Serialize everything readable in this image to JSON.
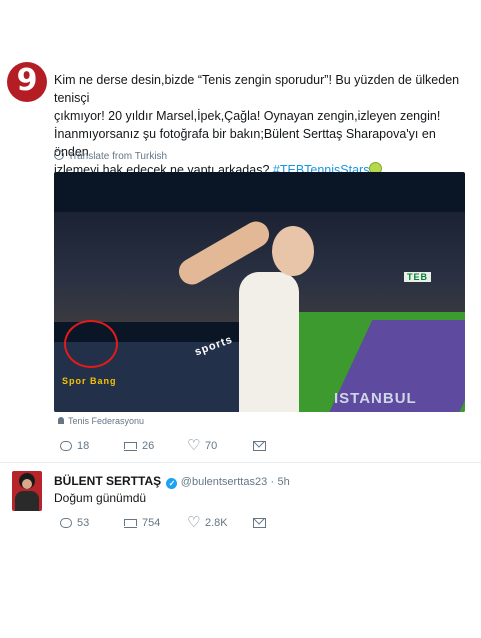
{
  "tweet1": {
    "avatar_text": "9",
    "text_lines": [
      "Kim ne derse desin,bizde “Tenis zengin sporudur”! Bu yüzden de ülkeden tenisçi",
      "çıkmıyor! 20 yıldır Marsel,İpek,Çağla! Oynayan zengin,izleyen zengin!",
      "İnanmıyorsanız şu fotoğrafa  bir bakın;Bülent Serttaş Sharapova'yı en önden",
      "izlemeyi hak edecek ne yaptı arkadaş?"
    ],
    "hashtag": "#TEBTennisStars",
    "translate_label": "Translate from Turkish",
    "photo": {
      "banner_left": "Spor Bang",
      "banner_sports": "sports",
      "banner_istanbul": "ISTANBUL",
      "banner_teb": "TEB"
    },
    "attribution": "Tenis Federasyonu",
    "replies": "18",
    "retweets": "26",
    "likes": "70"
  },
  "tweet2": {
    "name": "BÜLENT SERTTAŞ",
    "verified_glyph": "✓",
    "handle": "@bulentserttas23",
    "separator": "·",
    "time": "5h",
    "text": "Doğum günümdü",
    "replies": "53",
    "retweets": "754",
    "likes": "2.8K"
  },
  "colors": {
    "link": "#1b95e0",
    "muted": "#657786",
    "verified": "#1da1f2",
    "brand_red": "#b51d24"
  },
  "icons": [
    "globe-icon",
    "person-icon",
    "reply-icon",
    "retweet-icon",
    "heart-icon",
    "direct-message-icon",
    "verified-icon"
  ]
}
